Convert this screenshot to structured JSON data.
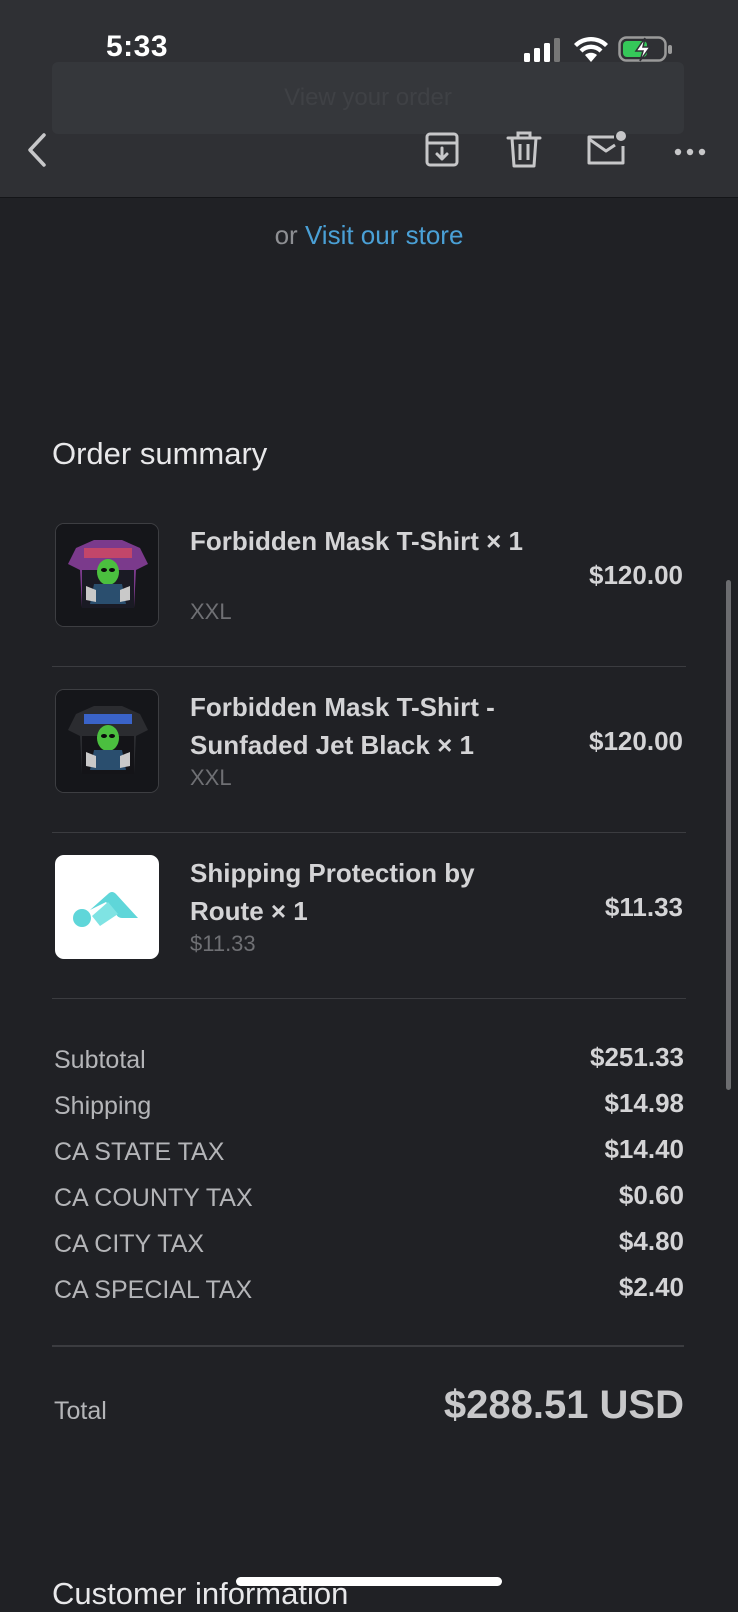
{
  "status_bar": {
    "time": "5:33"
  },
  "header": {
    "hidden_button_label": "View your order"
  },
  "toolbar": {
    "back_icon": "chevron-left-icon",
    "archive_icon": "archive-icon",
    "delete_icon": "trash-icon",
    "mark_unread_icon": "mail-unread-icon",
    "more_icon": "more-icon"
  },
  "visit": {
    "or_text": "or",
    "link_text": "Visit our store"
  },
  "order_summary": {
    "title": "Order summary",
    "items": [
      {
        "title": "Forbidden Mask T-Shirt × 1",
        "variant": "XXL",
        "price": "$120.00"
      },
      {
        "title": "Forbidden Mask T-Shirt - Sunfaded Jet Black × 1",
        "variant": "XXL",
        "price": "$120.00"
      },
      {
        "title": "Shipping Protection by Route × 1",
        "variant": "$11.33",
        "price": "$11.33"
      }
    ]
  },
  "totals": {
    "rows": [
      {
        "label": "Subtotal",
        "value": "$251.33"
      },
      {
        "label": "Shipping",
        "value": "$14.98"
      },
      {
        "label": "CA STATE TAX",
        "value": "$14.40"
      },
      {
        "label": "CA COUNTY TAX",
        "value": "$0.60"
      },
      {
        "label": "CA CITY TAX",
        "value": "$4.80"
      },
      {
        "label": "CA SPECIAL TAX",
        "value": "$2.40"
      }
    ],
    "total_label": "Total",
    "total_value": "$288.51 USD"
  },
  "customer_information": {
    "title": "Customer information"
  },
  "colors": {
    "background": "#202125",
    "toolbar": "#2f3034",
    "link": "#4aa0d6",
    "route_logo": "#5fd6d9"
  }
}
